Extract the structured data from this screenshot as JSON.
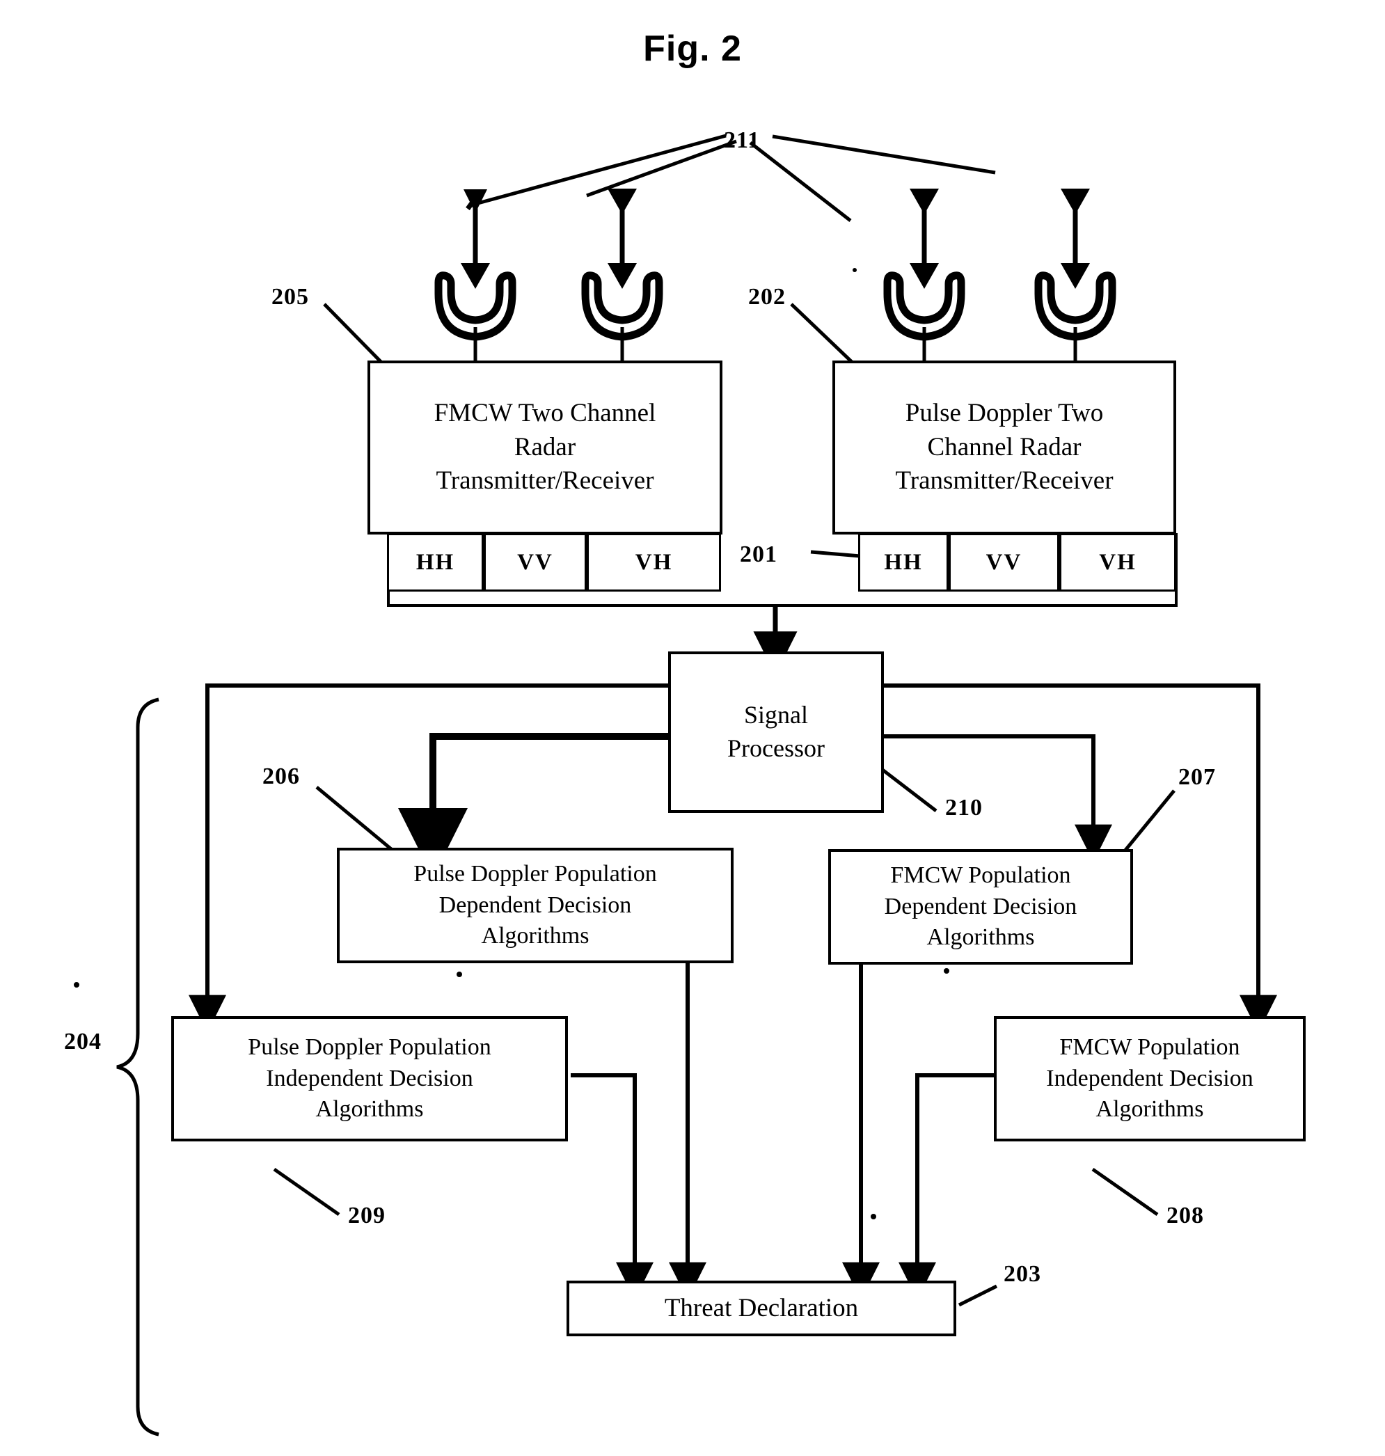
{
  "figure": {
    "title": "Fig. 2",
    "type": "patent-block-diagram"
  },
  "nodes": {
    "radar_left": {
      "ref": "205",
      "line1": "FMCW Two Channel",
      "line2": "Radar",
      "line3": "Transmitter/Receiver"
    },
    "radar_right": {
      "ref": "202",
      "line1": "Pulse Doppler Two",
      "line2": "Channel Radar",
      "line3": "Transmitter/Receiver"
    },
    "signal_processor": {
      "ref": "210",
      "line1": "Signal",
      "line2": "Processor"
    },
    "pd_dependent": {
      "ref": "206",
      "line1": "Pulse Doppler Population",
      "line2": "Dependent Decision",
      "line3": "Algorithms"
    },
    "fmcw_dependent": {
      "ref": "207",
      "line1": "FMCW Population",
      "line2": "Dependent Decision",
      "line3": "Algorithms"
    },
    "pd_independent": {
      "ref": "209",
      "line1": "Pulse Doppler Population",
      "line2": "Independent Decision",
      "line3": "Algorithms"
    },
    "fmcw_independent": {
      "ref": "208",
      "line1": "FMCW Population",
      "line2": "Independent Decision",
      "line3": "Algorithms"
    },
    "threat_declaration": {
      "ref": "203",
      "line1": "Threat Declaration"
    }
  },
  "polarization": {
    "left": [
      "HH",
      "VV",
      "VH"
    ],
    "right": [
      "HH",
      "VV",
      "VH"
    ],
    "bus_ref": "201"
  },
  "reference_numerals": {
    "antennas": "211",
    "polarization_bus": "201",
    "pulse_doppler_radar": "202",
    "threat_declaration": "203",
    "decision_group_brace": "204",
    "fmcw_radar": "205",
    "pd_population_dependent": "206",
    "fmcw_population_dependent": "207",
    "fmcw_population_independent": "208",
    "pd_population_independent": "209",
    "signal_processor": "210"
  },
  "antennas": {
    "count": 4,
    "label": "211",
    "description": "four dish antennas with bidirectional transmit/receive arrows"
  },
  "colors": {
    "stroke": "#000000",
    "background": "#ffffff"
  }
}
